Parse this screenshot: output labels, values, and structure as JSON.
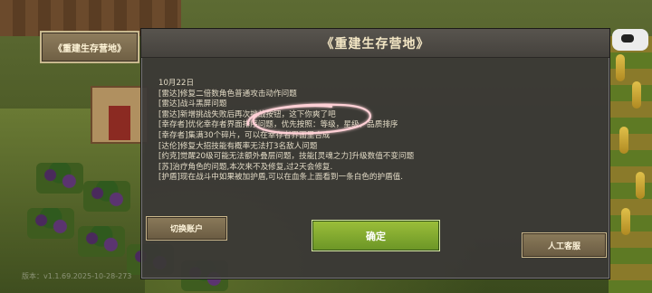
{
  "title_button": {
    "label": "《重建生存营地》"
  },
  "dialog": {
    "title": "《重建生存营地》",
    "date": "10月22日",
    "lines": [
      "[雷达]修复二倍数角色普通攻击动作问题",
      "[雷达]战斗黑屏问题",
      "[雷达]新增挑战失败后再次挑战按钮，这下你爽了吧",
      "[幸存者]优化幸存者界面排序问题，优先按照：等级，星级，品质排序",
      "[幸存者]集满30个碎片，可以在幸存者界面里合成",
      "[达伦]修复大招技能有概率无法打3名敌人问题",
      "[约克]觉醒20级可能无法额外叠层问题，技能[灵魂之力]升级数值不变问题",
      "[苏]治疗角色的问题,本次来不及修复,过2天会修复.",
      "[护盾]现在战斗中如果被加护盾,可以在血条上面看到一条白色的护盾值."
    ]
  },
  "buttons": {
    "switch_account": "切换账户",
    "confirm": "确定",
    "customer_service": "人工客服"
  },
  "version": "版本：v1.1.69.2025-10-28-273",
  "colors": {
    "confirm_green": "#7fa82e",
    "scribble_pink": "#ff9aa8",
    "dialog_bg": "#3a3836"
  }
}
